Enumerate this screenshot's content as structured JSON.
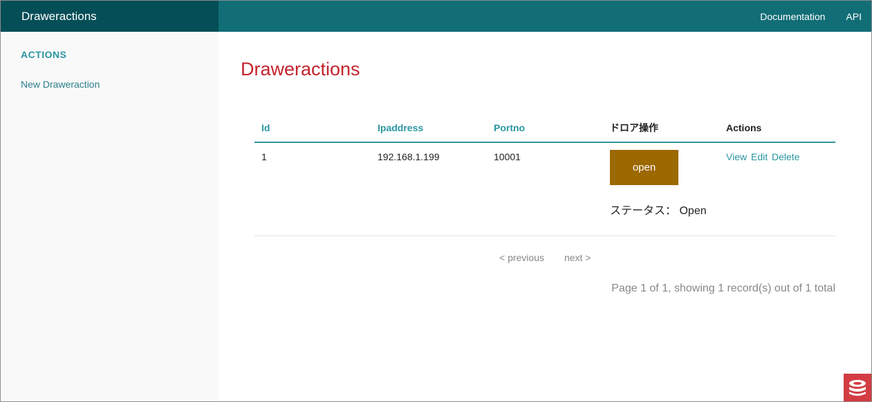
{
  "header": {
    "brand": "Draweractions",
    "nav": [
      "Documentation",
      "API"
    ]
  },
  "sidebar": {
    "heading": "ACTIONS",
    "links": [
      "New Draweraction"
    ]
  },
  "main": {
    "title": "Draweractions",
    "table": {
      "columns": [
        "Id",
        "Ipaddress",
        "Portno",
        "ドロア操作",
        "Actions"
      ],
      "rows": [
        {
          "id": "1",
          "ipaddress": "192.168.1.199",
          "portno": "10001",
          "button_label": "open",
          "status_label": "ステータス：",
          "status_value": "Open",
          "actions": [
            "View",
            "Edit",
            "Delete"
          ]
        }
      ]
    },
    "pager": {
      "previous": "< previous",
      "next": "next >",
      "counter": "Page 1 of 1, showing 1 record(s) out of 1 total"
    }
  },
  "colors": {
    "header": "#116d76",
    "brand_bg": "#034e57",
    "accent": "#2a96a1",
    "title": "#c3232d",
    "drawer_button": "#9c6800",
    "logo": "#d33c43"
  },
  "icons": {
    "logo": "cakephp-logo-icon"
  }
}
